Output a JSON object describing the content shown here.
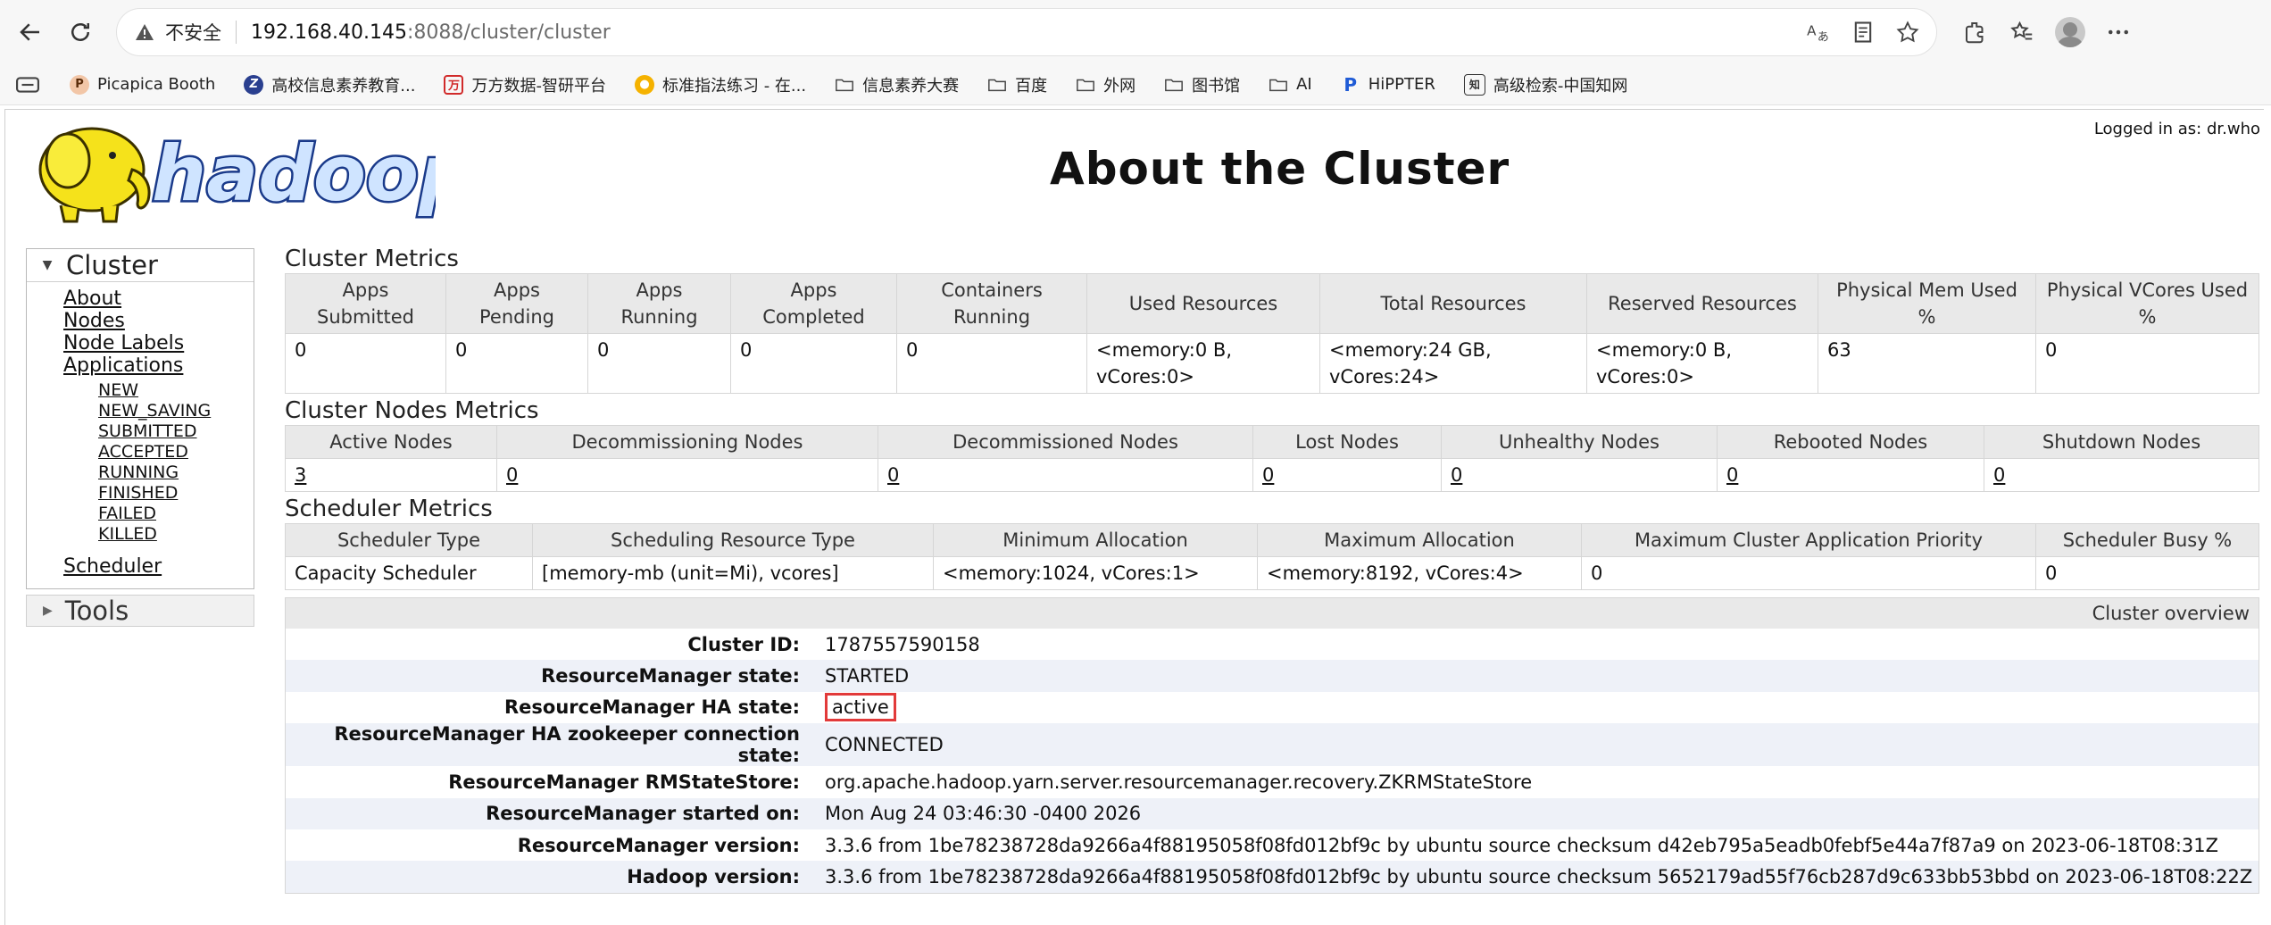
{
  "browser": {
    "insecure_label": "不安全",
    "url_host": "192.168.40.145",
    "url_path": ":8088/cluster/cluster",
    "bookmarks": [
      {
        "label": "Picapica Booth"
      },
      {
        "label": "高校信息素养教育..."
      },
      {
        "label": "万方数据-智研平台"
      },
      {
        "label": "标准指法练习 - 在..."
      },
      {
        "label": "信息素养大赛"
      },
      {
        "label": "百度"
      },
      {
        "label": "外网"
      },
      {
        "label": "图书馆"
      },
      {
        "label": "AI"
      },
      {
        "label": "HiPPTER"
      },
      {
        "label": "高级检索-中国知网"
      }
    ]
  },
  "header": {
    "logged_in": "Logged in as: dr.who",
    "title": "About the Cluster",
    "logo_text": "hadoop"
  },
  "sidebar": {
    "cluster_label": "Cluster",
    "links": [
      "About",
      "Nodes",
      "Node Labels",
      "Applications"
    ],
    "app_states": [
      "NEW",
      "NEW_SAVING",
      "SUBMITTED",
      "ACCEPTED",
      "RUNNING",
      "FINISHED",
      "FAILED",
      "KILLED"
    ],
    "scheduler_label": "Scheduler",
    "tools_label": "Tools"
  },
  "cluster_metrics": {
    "title": "Cluster Metrics",
    "headers": [
      "Apps Submitted",
      "Apps Pending",
      "Apps Running",
      "Apps Completed",
      "Containers Running",
      "Used Resources",
      "Total Resources",
      "Reserved Resources",
      "Physical Mem Used %",
      "Physical VCores Used %"
    ],
    "values": [
      "0",
      "0",
      "0",
      "0",
      "0",
      "<memory:0 B, vCores:0>",
      "<memory:24 GB, vCores:24>",
      "<memory:0 B, vCores:0>",
      "63",
      "0"
    ]
  },
  "node_metrics": {
    "title": "Cluster Nodes Metrics",
    "headers": [
      "Active Nodes",
      "Decommissioning Nodes",
      "Decommissioned Nodes",
      "Lost Nodes",
      "Unhealthy Nodes",
      "Rebooted Nodes",
      "Shutdown Nodes"
    ],
    "values": [
      "3",
      "0",
      "0",
      "0",
      "0",
      "0",
      "0"
    ]
  },
  "scheduler_metrics": {
    "title": "Scheduler Metrics",
    "headers": [
      "Scheduler Type",
      "Scheduling Resource Type",
      "Minimum Allocation",
      "Maximum Allocation",
      "Maximum Cluster Application Priority",
      "Scheduler Busy %"
    ],
    "values": [
      "Capacity Scheduler",
      "[memory-mb (unit=Mi), vcores]",
      "<memory:1024, vCores:1>",
      "<memory:8192, vCores:4>",
      "0",
      "0"
    ]
  },
  "overview": {
    "title": "Cluster overview",
    "rows": [
      {
        "key": "Cluster ID:",
        "value": "1787557590158"
      },
      {
        "key": "ResourceManager state:",
        "value": "STARTED"
      },
      {
        "key": "ResourceManager HA state:",
        "value": "active"
      },
      {
        "key": "ResourceManager HA zookeeper connection state:",
        "value": "CONNECTED"
      },
      {
        "key": "ResourceManager RMStateStore:",
        "value": "org.apache.hadoop.yarn.server.resourcemanager.recovery.ZKRMStateStore"
      },
      {
        "key": "ResourceManager started on:",
        "value": "Mon Aug 24 03:46:30 -0400 2026"
      },
      {
        "key": "ResourceManager version:",
        "value": "3.3.6 from 1be78238728da9266a4f88195058f08fd012bf9c by ubuntu source checksum d42eb795a5eadb0febf5e44a7f87a9 on 2023-06-18T08:31Z"
      },
      {
        "key": "Hadoop version:",
        "value": "3.3.6 from 1be78238728da9266a4f88195058f08fd012bf9c by ubuntu source checksum 5652179ad55f76cb287d9c633bb53bbd on 2023-06-18T08:22Z"
      }
    ]
  },
  "colors": {
    "highlight_box": "#e23a3a",
    "table_header_bg": "#e9e9e9",
    "overview_alt_row": "#eef1f8",
    "logo_blue": "#1a3a8a",
    "logo_yellow": "#f5e21b"
  }
}
